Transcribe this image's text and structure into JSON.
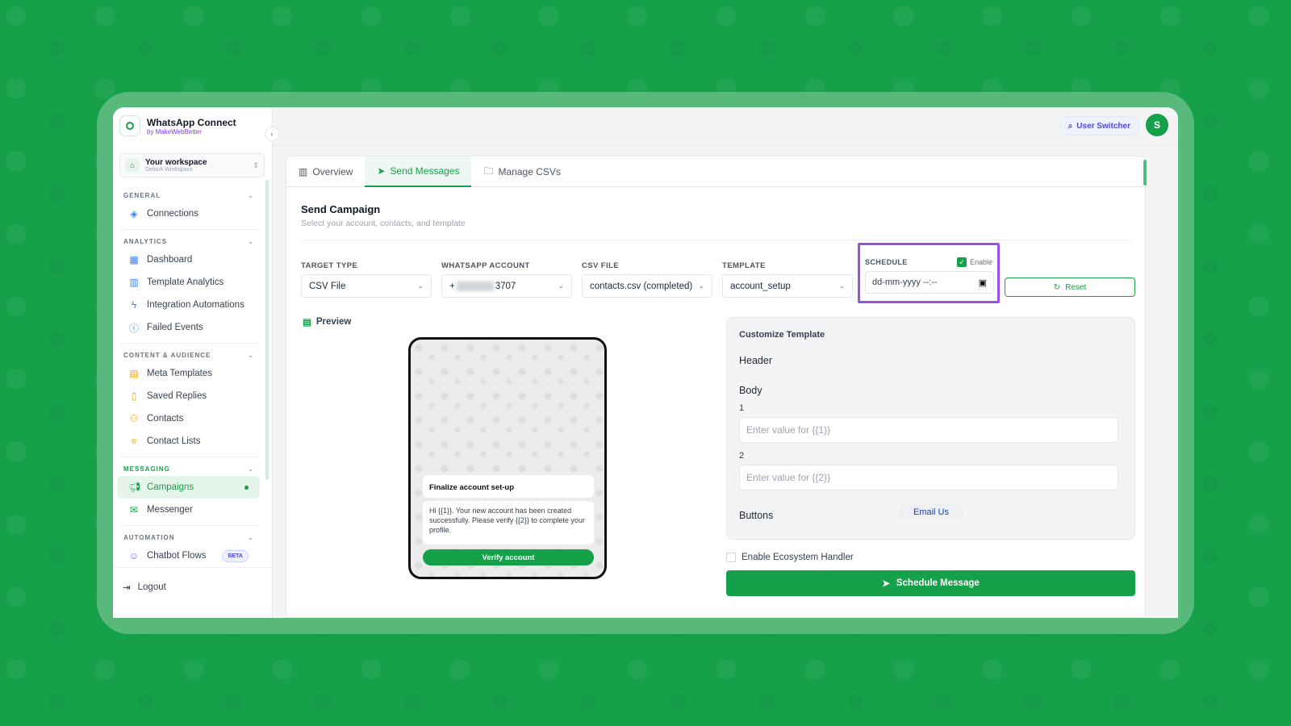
{
  "brand": {
    "title": "WhatsApp Connect",
    "subtitle": "by MakeWebBetter"
  },
  "workspace": {
    "name": "Your workspace",
    "sub": "Default Workspace"
  },
  "nav": {
    "general": "GENERAL",
    "connections": "Connections",
    "analytics": "ANALYTICS",
    "dashboard": "Dashboard",
    "template_analytics": "Template Analytics",
    "integration_automations": "Integration Automations",
    "failed_events": "Failed Events",
    "content_audience": "CONTENT & AUDIENCE",
    "meta_templates": "Meta Templates",
    "saved_replies": "Saved Replies",
    "contacts": "Contacts",
    "contact_lists": "Contact Lists",
    "messaging": "MESSAGING",
    "campaigns": "Campaigns",
    "messenger": "Messenger",
    "automation": "AUTOMATION",
    "chatbot_flows": "Chatbot Flows",
    "beta": "BETA",
    "logout": "Logout"
  },
  "topbar": {
    "user_switcher": "User Switcher",
    "avatar_initial": "S"
  },
  "tabs": {
    "overview": "Overview",
    "send_messages": "Send Messages",
    "manage_csvs": "Manage CSVs"
  },
  "campaign": {
    "title": "Send Campaign",
    "subtitle": "Select your account, contacts, and template",
    "target_type_label": "TARGET TYPE",
    "target_type_value": "CSV File",
    "whatsapp_account_label": "WHATSAPP ACCOUNT",
    "whatsapp_account_prefix": "+",
    "whatsapp_account_suffix": "3707",
    "csv_file_label": "CSV FILE",
    "csv_file_value": "contacts.csv (completed)",
    "template_label": "TEMPLATE",
    "template_value": "account_setup",
    "schedule_label": "SCHEDULE",
    "schedule_enable": "Enable",
    "schedule_placeholder": "dd-mm-yyyy --:--",
    "reset": "Reset"
  },
  "preview": {
    "label": "Preview",
    "title": "Finalize account set-up",
    "body": "Hi {{1}}. Your new account has been created successfully. Please verify {{2}} to complete your profile.",
    "button": "Verify account"
  },
  "customize": {
    "title": "Customize Template",
    "header": "Header",
    "body": "Body",
    "var1_label": "1",
    "var1_placeholder": "Enter value for {{1}}",
    "var2_label": "2",
    "var2_placeholder": "Enter value for {{2}}",
    "buttons": "Buttons",
    "email_us": "Email Us"
  },
  "ecosystem": "Enable Ecosystem Handler",
  "schedule_message": "Schedule Message",
  "colors": {
    "brand_green": "#16a04a",
    "highlight_purple": "#9b51e0"
  }
}
